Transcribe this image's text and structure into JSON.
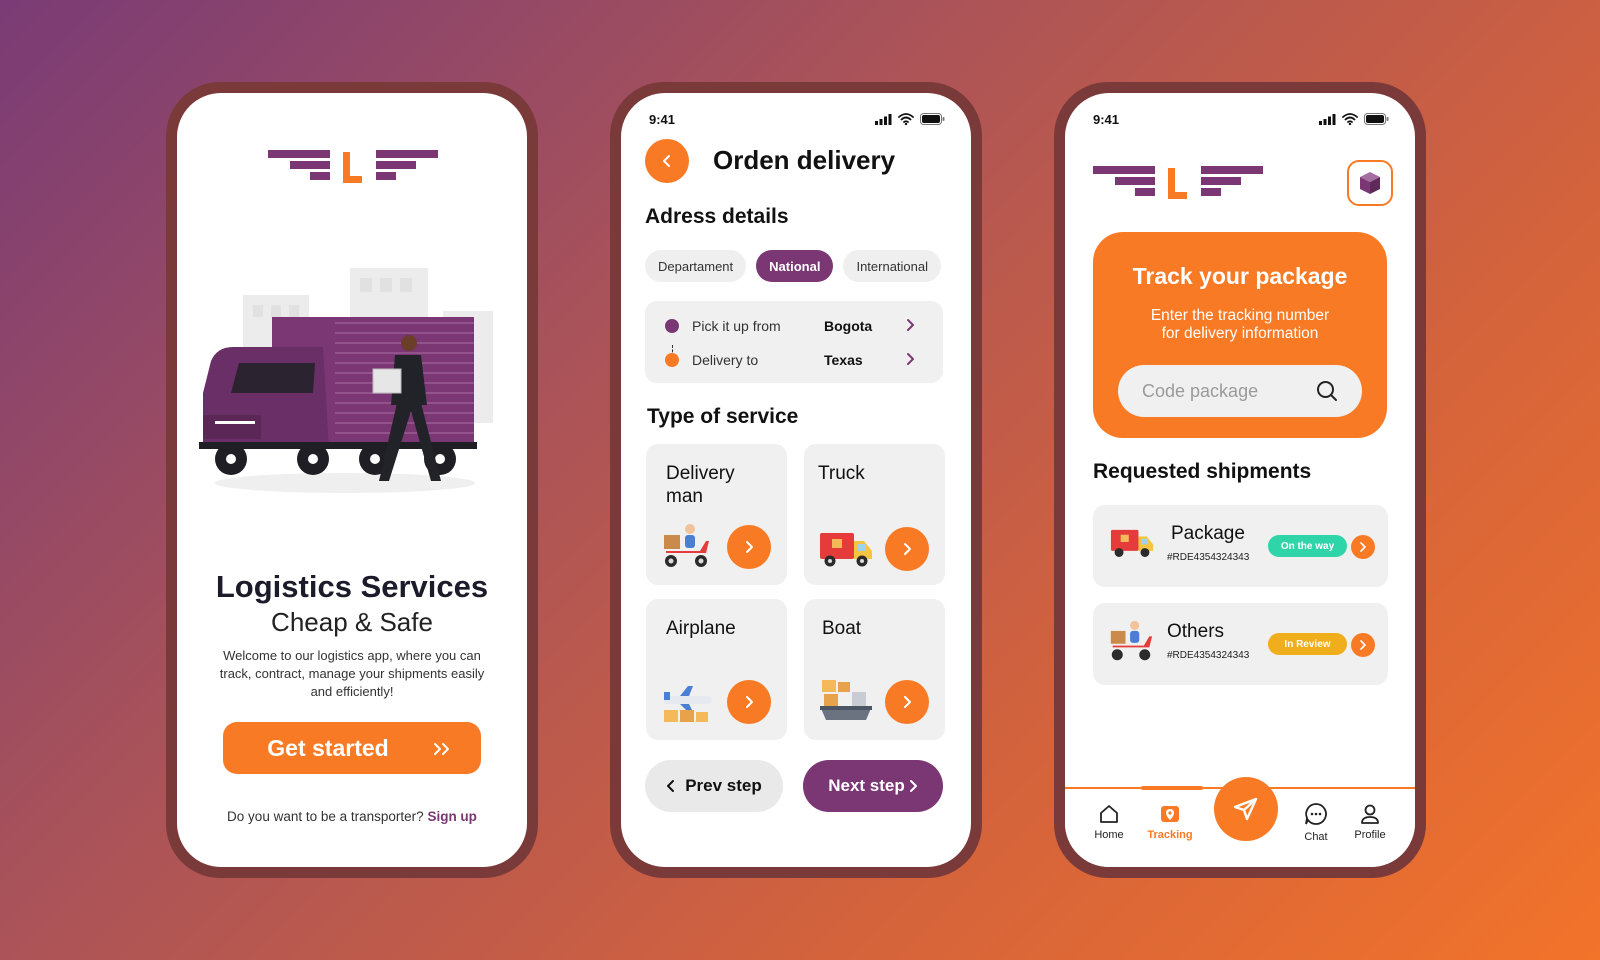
{
  "colors": {
    "accent": "#f97a24",
    "brand_purple": "#7b3774",
    "teal_badge": "#2fd4a8",
    "yellow_badge": "#f0ad1c"
  },
  "welcome": {
    "title": "Logistics Services",
    "subtitle": "Cheap & Safe",
    "description": "Welcome to our logistics app, where you can track, contract, manage your shipments easily and efficiently!",
    "cta_label": "Get started",
    "cta_icon": "double-chevron-right-icon",
    "footer_question": "Do you want to be a transporter?",
    "footer_link": "Sign up"
  },
  "order": {
    "status_time": "9:41",
    "title": "Orden delivery",
    "address_heading": "Adress details",
    "tabs": [
      {
        "label": "Departament",
        "active": false
      },
      {
        "label": "National",
        "active": true
      },
      {
        "label": "International",
        "active": false
      }
    ],
    "pickup_label": "Pick it up from",
    "pickup_value": "Bogota",
    "delivery_label": "Delivery to",
    "delivery_value": "Texas",
    "service_heading": "Type of service",
    "services": [
      {
        "name": "Delivery man",
        "icon": "scooter-courier-icon"
      },
      {
        "name": "Truck",
        "icon": "delivery-truck-icon"
      },
      {
        "name": "Airplane",
        "icon": "cargo-airplane-icon"
      },
      {
        "name": "Boat",
        "icon": "cargo-ship-icon"
      }
    ],
    "prev_label": "Prev step",
    "next_label": "Next step"
  },
  "tracking": {
    "status_time": "9:41",
    "card_title": "Track your package",
    "card_desc_line1": "Enter the tracking number",
    "card_desc_line2": "for delivery information",
    "search_placeholder": "Code package",
    "requested_heading": "Requested shipments",
    "shipments": [
      {
        "name": "Package",
        "code": "#RDE4354324343",
        "status": "On the way",
        "icon": "delivery-truck-icon"
      },
      {
        "name": "Others",
        "code": "#RDE4354324343",
        "status": "In Review",
        "icon": "scooter-courier-icon"
      }
    ],
    "nav": [
      {
        "label": "Home",
        "icon": "home-icon",
        "active": false
      },
      {
        "label": "Tracking",
        "icon": "map-pin-icon",
        "active": true
      },
      {
        "label": "Chat",
        "icon": "chat-icon",
        "active": false
      },
      {
        "label": "Profile",
        "icon": "profile-icon",
        "active": false
      }
    ],
    "center_action_icon": "send-icon"
  }
}
